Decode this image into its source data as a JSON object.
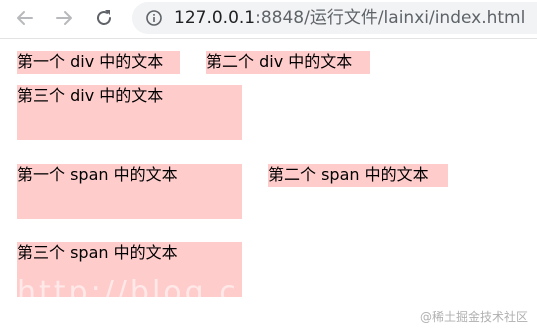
{
  "browser": {
    "url_host": "127.0.0.1",
    "url_rest": ":8848/运行文件/lainxi/index.html"
  },
  "page": {
    "div1_text": "第一个 div 中的文本",
    "div2_text": "第二个 div 中的文本",
    "div3_text": "第三个 div 中的文本",
    "span1_text": "第一个 span 中的文本",
    "span2_text": "第二个 span 中的文本",
    "span3_text": "第三个 span 中的文本",
    "ghost_text": "http://blog.c"
  },
  "watermark": {
    "text": "@稀土掘金技术社区"
  },
  "colors": {
    "box_bg": "#ffcccc",
    "omnibox_bg": "#f1f3f4"
  }
}
